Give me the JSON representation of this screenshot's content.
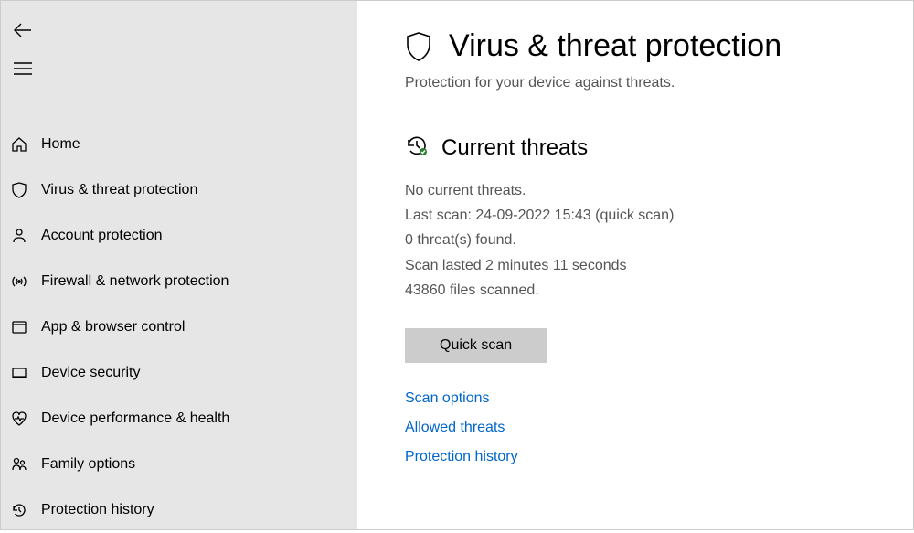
{
  "header": {
    "title": "Virus & threat protection",
    "subtitle": "Protection for your device against threats."
  },
  "sidebar": {
    "items": [
      {
        "icon": "home-icon",
        "label": "Home"
      },
      {
        "icon": "shield-icon",
        "label": "Virus & threat protection"
      },
      {
        "icon": "account-icon",
        "label": "Account protection"
      },
      {
        "icon": "firewall-icon",
        "label": "Firewall & network protection"
      },
      {
        "icon": "app-browser-icon",
        "label": "App & browser control"
      },
      {
        "icon": "device-icon",
        "label": "Device security"
      },
      {
        "icon": "health-icon",
        "label": "Device performance & health"
      },
      {
        "icon": "family-icon",
        "label": "Family options"
      },
      {
        "icon": "history-icon",
        "label": "Protection history"
      }
    ]
  },
  "section": {
    "title": "Current threats",
    "status": {
      "line1": "No current threats.",
      "line2": "Last scan: 24-09-2022 15:43 (quick scan)",
      "line3": "0 threat(s) found.",
      "line4": "Scan lasted 2 minutes 11 seconds",
      "line5": "43860 files scanned."
    }
  },
  "buttons": {
    "quick_scan": "Quick scan"
  },
  "links": {
    "scan_options": "Scan options",
    "allowed_threats": "Allowed threats",
    "protection_history": "Protection history"
  }
}
